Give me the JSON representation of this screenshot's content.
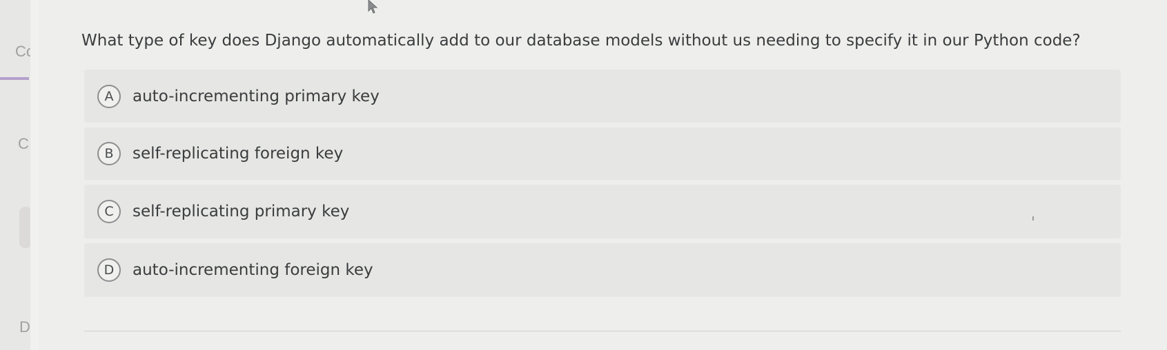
{
  "sidebar": {
    "letters": [
      "Co",
      "C",
      "D"
    ]
  },
  "question": {
    "text": "What type of key does Django automatically add to our database models without us needing to specify it in our Python code?"
  },
  "options": [
    {
      "letter": "A",
      "text": "auto-incrementing primary key"
    },
    {
      "letter": "B",
      "text": "self-replicating foreign key"
    },
    {
      "letter": "C",
      "text": "self-replicating primary key"
    },
    {
      "letter": "D",
      "text": "auto-incrementing foreign key"
    }
  ],
  "colors": {
    "accent": "#b4a0cc",
    "background": "#eeeeec",
    "option_background": "#e6e6e4"
  },
  "icons": {
    "cursor": "cursor-arrow-icon"
  }
}
